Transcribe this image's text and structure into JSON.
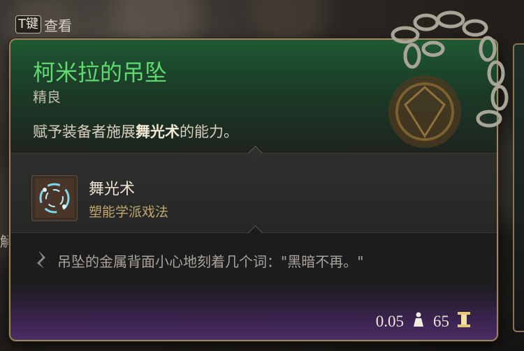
{
  "hint": {
    "key": "T键",
    "label": "查看"
  },
  "left_edge_text": "解",
  "item": {
    "name": "柯米拉的吊坠",
    "rarity": "精良",
    "desc_before": "赋予装备者施展",
    "desc_highlight": "舞光术",
    "desc_after": "的能力。"
  },
  "spell": {
    "name": "舞光术",
    "school": "塑能学派戏法",
    "icon": "dancing-lights-icon"
  },
  "lore": "吊坠的金属背面小心地刻着几个词：\"黑暗不再。\"",
  "stats": {
    "weight": "0.05",
    "weight_icon": "weight-icon",
    "value": "65",
    "value_icon": "gold-icon"
  },
  "colors": {
    "name": "#5fd870",
    "rarity_bg": "#1f5a33",
    "school": "#bfa56e",
    "border": "#9c8560"
  }
}
